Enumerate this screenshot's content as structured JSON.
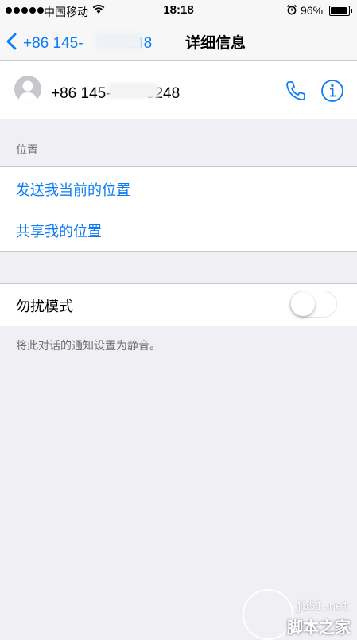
{
  "status_bar": {
    "carrier": "中国移动",
    "time": "18:18",
    "battery": "96%",
    "battery_level": 0.96
  },
  "nav": {
    "back_label": "+86 145-　　-5248",
    "title": "详细信息"
  },
  "contact": {
    "number": "+86 145-　　-5248"
  },
  "location": {
    "section_label": "位置",
    "send_current": "发送我当前的位置",
    "share_location": "共享我的位置"
  },
  "dnd": {
    "label": "勿扰模式",
    "enabled": false,
    "note": "将此对话的通知设置为静音。"
  },
  "watermark": {
    "site": "jb51.net",
    "name": "脚本之家"
  },
  "colors": {
    "accent": "#0b7cf5",
    "background": "#efeff4"
  }
}
